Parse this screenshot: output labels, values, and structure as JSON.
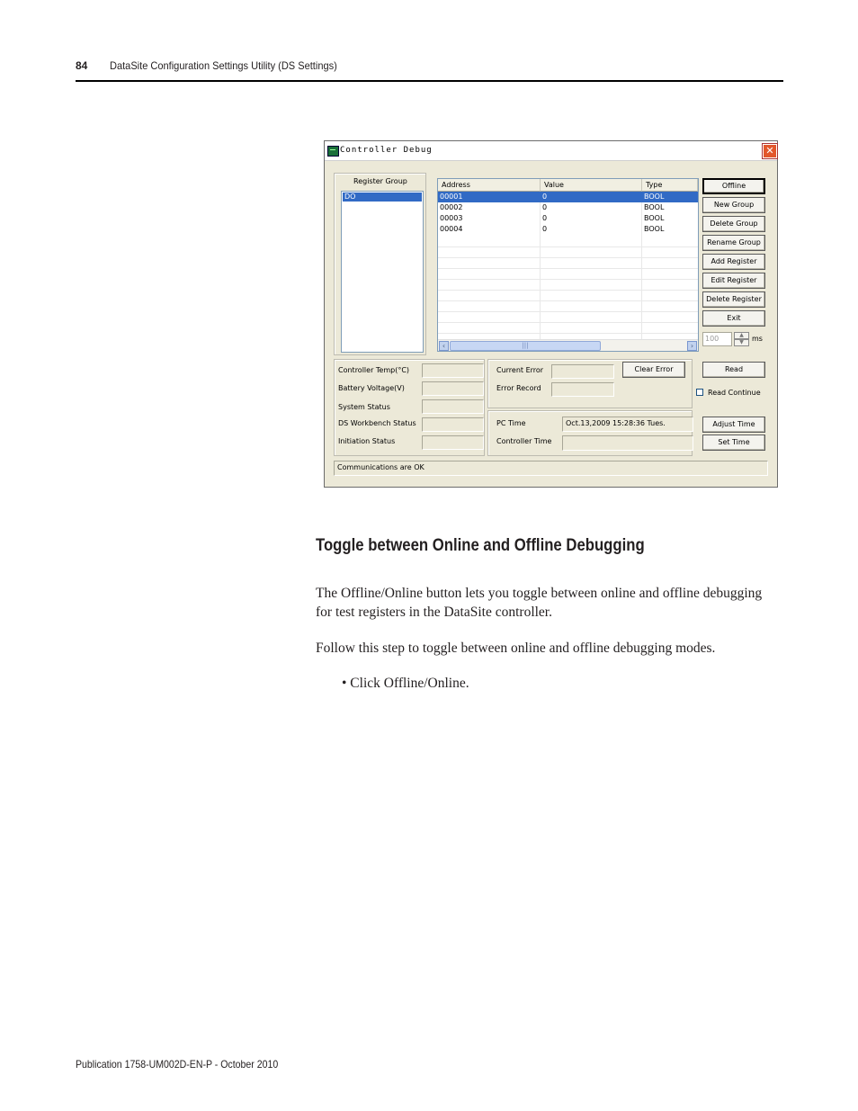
{
  "header": {
    "page_number": "84",
    "title": "DataSite Configuration Settings Utility (DS Settings)"
  },
  "dialog": {
    "title": "Controller Debug",
    "close_glyph": "✕",
    "register_group": {
      "label": "Register Group",
      "items": [
        "DO"
      ]
    },
    "table": {
      "columns": [
        "Address",
        "Value",
        "Type"
      ],
      "rows": [
        [
          "00001",
          "0",
          "BOOL"
        ],
        [
          "00002",
          "0",
          "BOOL"
        ],
        [
          "00003",
          "0",
          "BOOL"
        ],
        [
          "00004",
          "0",
          "BOOL"
        ]
      ],
      "scroll_left": "‹",
      "scroll_right": "›",
      "scroll_grip": "|||"
    },
    "buttons": {
      "offline": "Offline",
      "new_group": "New Group",
      "delete_group": "Delete Group",
      "rename_group": "Rename Group",
      "add_register": "Add Register",
      "edit_register": "Edit Register",
      "delete_register": "Delete Register",
      "exit": "Exit",
      "clear_error": "Clear Error",
      "read": "Read",
      "adjust_time": "Adjust Time",
      "set_time": "Set Time"
    },
    "interval": {
      "value": "100",
      "unit": "ms",
      "up": "▲",
      "down": "▼"
    },
    "read_continue_label": "Read Continue",
    "status_labels": {
      "controller_temp": "Controller Temp(°C)",
      "battery_voltage": "Battery Voltage(V)",
      "system_status": "System Status",
      "ds_workbench_status": "DS Workbench Status",
      "initiation_status": "Initiation Status"
    },
    "error_labels": {
      "current_error": "Current Error",
      "error_record": "Error Record"
    },
    "time": {
      "pc_time_label": "PC Time",
      "pc_time_value": "Oct.13,2009 15:28:36  Tues.",
      "controller_time_label": "Controller Time"
    },
    "status_bar": "Communications are OK"
  },
  "section": {
    "heading": "Toggle between Online and Offline Debugging",
    "paragraph1": "The Offline/Online button lets you toggle between online and offline debugging for test registers in the DataSite controller.",
    "paragraph2": "Follow this step to toggle between online and offline debugging modes.",
    "bullet": "• Click Offline/Online."
  },
  "footer": "Publication 1758-UM002D-EN-P - October 2010",
  "colors": {
    "selection": "#316ac5",
    "window_bg": "#ece9d8",
    "close_button": "#e2572c"
  }
}
